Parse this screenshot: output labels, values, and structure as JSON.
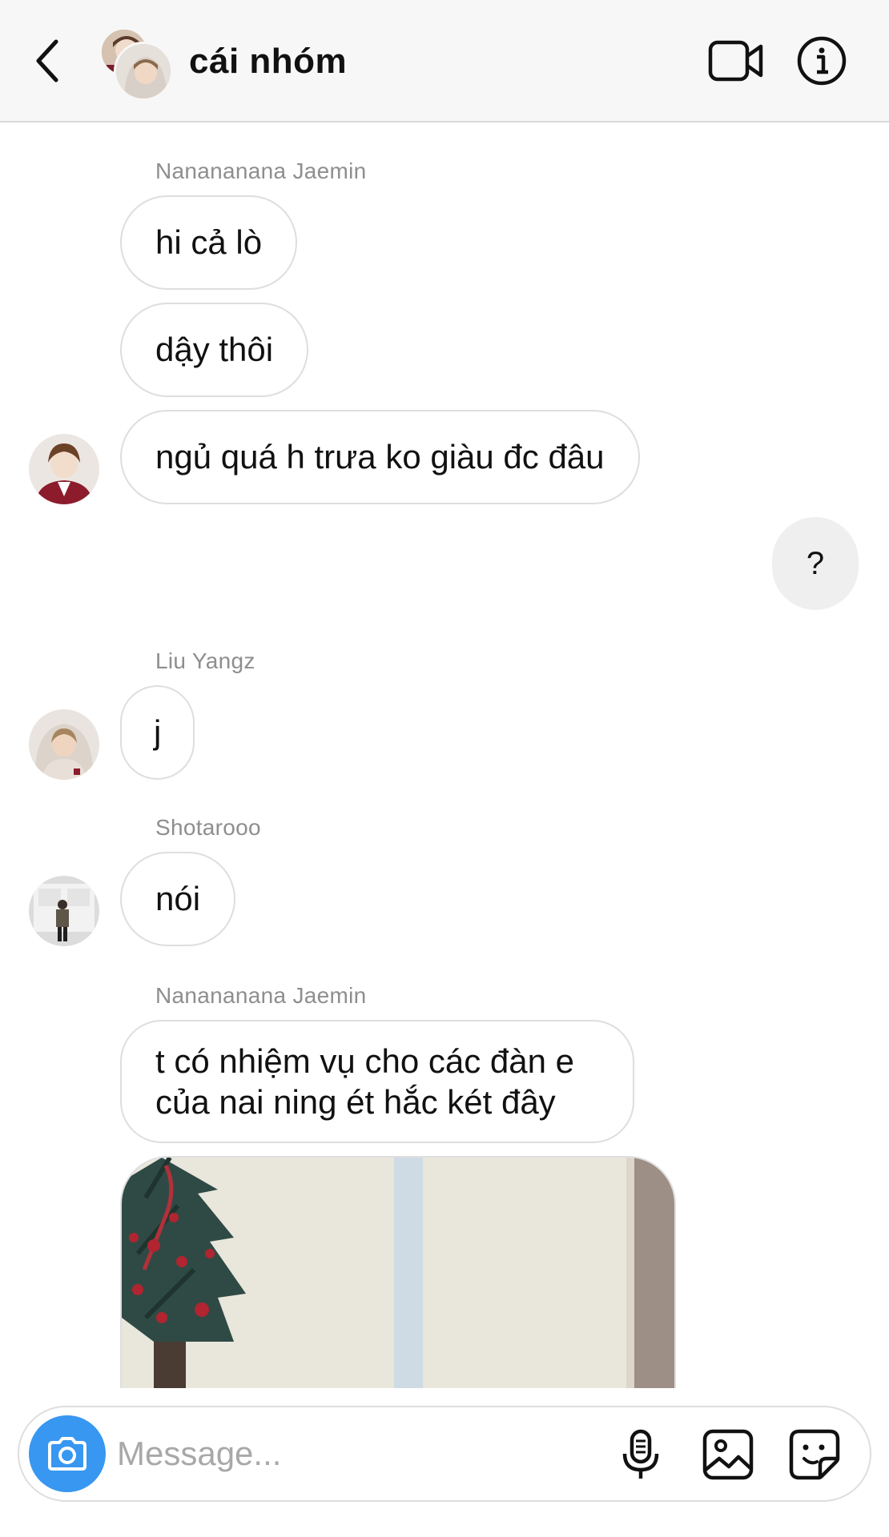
{
  "header": {
    "title": "cái nhóm"
  },
  "messages": [
    {
      "sender": "Nanananana Jaemin",
      "text": "hi cả lò"
    },
    {
      "text": "dậy thôi"
    },
    {
      "text": "ngủ quá h trưa ko giàu đc đâu"
    },
    {
      "self": true,
      "text": "?"
    },
    {
      "sender": "Liu Yangz",
      "text": "j"
    },
    {
      "sender": "Shotarooo",
      "text": "nói"
    },
    {
      "sender": "Nanananana Jaemin",
      "text": "t có nhiệm vụ cho các đàn e của nai ning ét hắc két đây"
    }
  ],
  "composer": {
    "placeholder": "Message..."
  },
  "icons": {
    "back": "chevron-left-icon",
    "video": "video-camera-icon",
    "info": "info-icon",
    "camera": "camera-icon",
    "mic": "microphone-icon",
    "gallery": "image-icon",
    "sticker": "sticker-icon"
  },
  "colors": {
    "accent": "#3897f0",
    "sender_name": "#8e8e8e",
    "self_bubble": "#efefef"
  }
}
